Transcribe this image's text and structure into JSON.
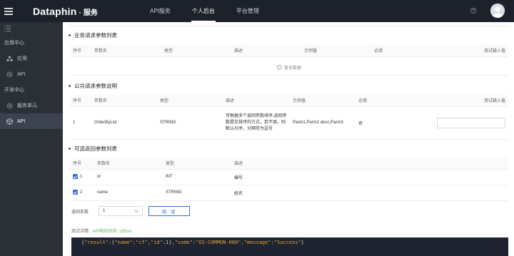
{
  "header": {
    "brand": "Dataphin",
    "dot": "·",
    "service": "服务",
    "nav": [
      {
        "label": "API服务"
      },
      {
        "label": "个人后台"
      },
      {
        "label": "平台管理"
      }
    ],
    "active_nav": "个人后台"
  },
  "sidebar": {
    "groups": [
      {
        "label": "应用中心",
        "items": [
          {
            "label": "应用",
            "icon": "apps-icon"
          },
          {
            "label": "API",
            "icon": "gear-icon"
          }
        ]
      },
      {
        "label": "开发中心",
        "items": [
          {
            "label": "服务单元",
            "icon": "gear-icon"
          },
          {
            "label": "API",
            "icon": "cube-icon",
            "active": true
          }
        ]
      }
    ]
  },
  "business_params": {
    "title": "业务请求参数列表",
    "columns": [
      "序号",
      "参数名",
      "类型",
      "描述",
      "示例值",
      "必填",
      "测试输入值"
    ],
    "empty_text": "暂无数据"
  },
  "public_params": {
    "title": "公共请求参数说明",
    "columns": [
      "序号",
      "参数名",
      "类型",
      "描述",
      "示例值",
      "必填",
      "测试输入值"
    ],
    "rows": [
      {
        "index": "1",
        "name": "OrderByList",
        "type": "STRING",
        "desc": "可根据多个返回参数排序,返回参数提交排序的方式，若不填，则默认升序，分隔符为逗号",
        "example": "Parm1,Parm2 desc,Parm3",
        "required": "否",
        "test_value": ""
      }
    ]
  },
  "optional_returns": {
    "title": "可选返回参数列表",
    "columns": [
      "序号",
      "参数名",
      "类型",
      "描述"
    ],
    "rows": [
      {
        "index": "1",
        "checked": true,
        "name": "id",
        "type": "INT",
        "desc": "编号"
      },
      {
        "index": "2",
        "checked": true,
        "name": "name",
        "type": "STRING",
        "desc": "姓名"
      }
    ]
  },
  "test": {
    "count_label": "返回条数",
    "count_value": "1",
    "button_label": "测 试",
    "detail_label": "测试详情:",
    "latency_text": "API响应时间: 135ms"
  },
  "result": {
    "brace_open": "{",
    "segments": [
      {
        "t": "k",
        "v": "\"result\""
      },
      {
        "t": "p",
        "v": ":{"
      },
      {
        "t": "k",
        "v": "\"name\""
      },
      {
        "t": "p",
        "v": ":"
      },
      {
        "t": "k",
        "v": "\"cf\""
      },
      {
        "t": "p",
        "v": ","
      },
      {
        "t": "k",
        "v": "\"id\""
      },
      {
        "t": "p",
        "v": ":1},"
      },
      {
        "t": "k",
        "v": "\"code\""
      },
      {
        "t": "p",
        "v": ":"
      },
      {
        "t": "k",
        "v": "\"OS-COMMON-000\""
      },
      {
        "t": "p",
        "v": ","
      },
      {
        "t": "k",
        "v": "\"message\""
      },
      {
        "t": "p",
        "v": ":"
      },
      {
        "t": "k",
        "v": "\"Success\""
      },
      {
        "t": "p",
        "v": "}"
      }
    ]
  },
  "colors": {
    "topbar": "#1d2129",
    "sidebar": "#2b2f36",
    "accent": "#2f72d8",
    "result_bg": "#1f2430",
    "result_key": "#e6a23c"
  }
}
